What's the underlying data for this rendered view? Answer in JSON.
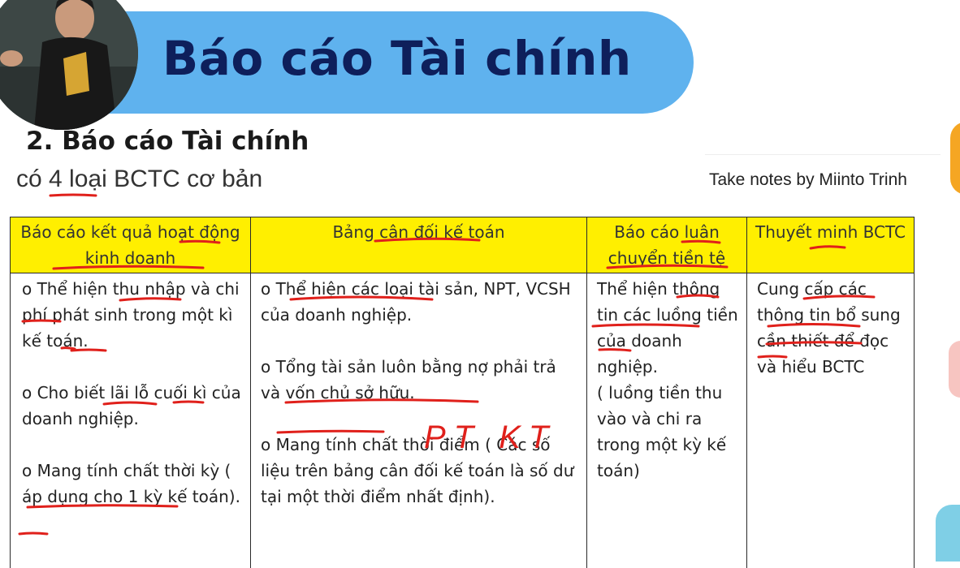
{
  "banner": {
    "title": "Báo cáo Tài chính"
  },
  "section": {
    "heading": "2. Báo cáo Tài chính",
    "subheading": "có 4 loại BCTC cơ bản"
  },
  "notes": "Take notes by Miinto Trinh",
  "handwriting": "PT KT",
  "table": {
    "headers": [
      "Báo cáo kết quả hoạt động kinh doanh",
      "Bảng cân đối kế toán",
      "Báo cáo luân chuyển tiền tệ",
      "Thuyết minh BCTC"
    ],
    "cells": [
      "o Thể hiện thu nhập và chi phí phát sinh trong một kì kế toán.\n\no Cho biết lãi lỗ cuối kì của doanh nghiệp.\n\no Mang tính chất thời kỳ ( áp dụng cho 1 kỳ kế toán).",
      "o Thể hiện các loại tài sản, NPT, VCSH của doanh nghiệp.\n\no Tổng tài sản luôn bằng nợ phải trả và vốn chủ sở hữu.\n\no Mang tính chất thời điểm ( Các số liệu trên bảng cân đối kế toán là số dư tại một thời điểm nhất định).",
      "Thể hiện thông tin các luồng tiền của doanh nghiệp.\n( luồng tiền thu vào và chi ra trong một kỳ kế toán)",
      "Cung cấp các thông tin bổ sung cần thiết để đọc và hiểu BCTC"
    ]
  },
  "colors": {
    "banner": "#5fb2ee",
    "title": "#0e1f5b",
    "header_fill": "#ffef00",
    "ink": "#e0201b"
  }
}
